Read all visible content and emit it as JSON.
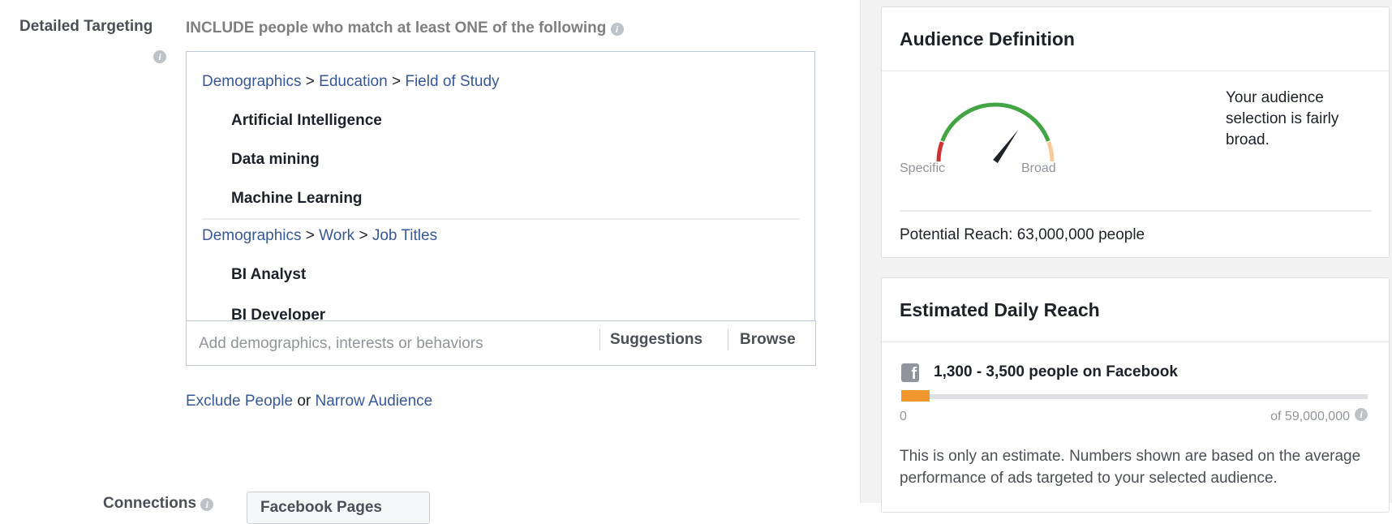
{
  "targeting": {
    "label": "Detailed Targeting",
    "include_text": "INCLUDE people who match at least ONE of the following",
    "groups": [
      {
        "path": [
          "Demographics",
          "Education",
          "Field of Study"
        ],
        "items": [
          "Artificial Intelligence",
          "Data mining",
          "Machine Learning"
        ]
      },
      {
        "path": [
          "Demographics",
          "Work",
          "Job Titles"
        ],
        "items": [
          "BI Analyst",
          "BI Developer"
        ]
      }
    ],
    "separator": ">",
    "input_placeholder": "Add demographics, interests or behaviors",
    "suggestions": "Suggestions",
    "browse": "Browse",
    "exclude": "Exclude People",
    "or": "or",
    "narrow": "Narrow Audience"
  },
  "connections": {
    "label": "Connections",
    "dropdown": "Facebook Pages"
  },
  "audience": {
    "title": "Audience Definition",
    "specific": "Specific",
    "broad": "Broad",
    "description": "Your audience selection is fairly broad.",
    "potential_reach": "Potential Reach: 63,000,000 people",
    "gauge_level": 0.7,
    "colors": {
      "red": "#d0302f",
      "green": "#42a443",
      "peach": "#f9c99b"
    }
  },
  "daily": {
    "title": "Estimated Daily Reach",
    "reach": "1,300 - 3,500 people on Facebook",
    "min": "0",
    "max": "of 59,000,000",
    "bar_fraction": 0.06,
    "bar_color": "#f0962d",
    "note": "This is only an estimate. Numbers shown are based on the average performance of ads targeted to your selected audience."
  }
}
